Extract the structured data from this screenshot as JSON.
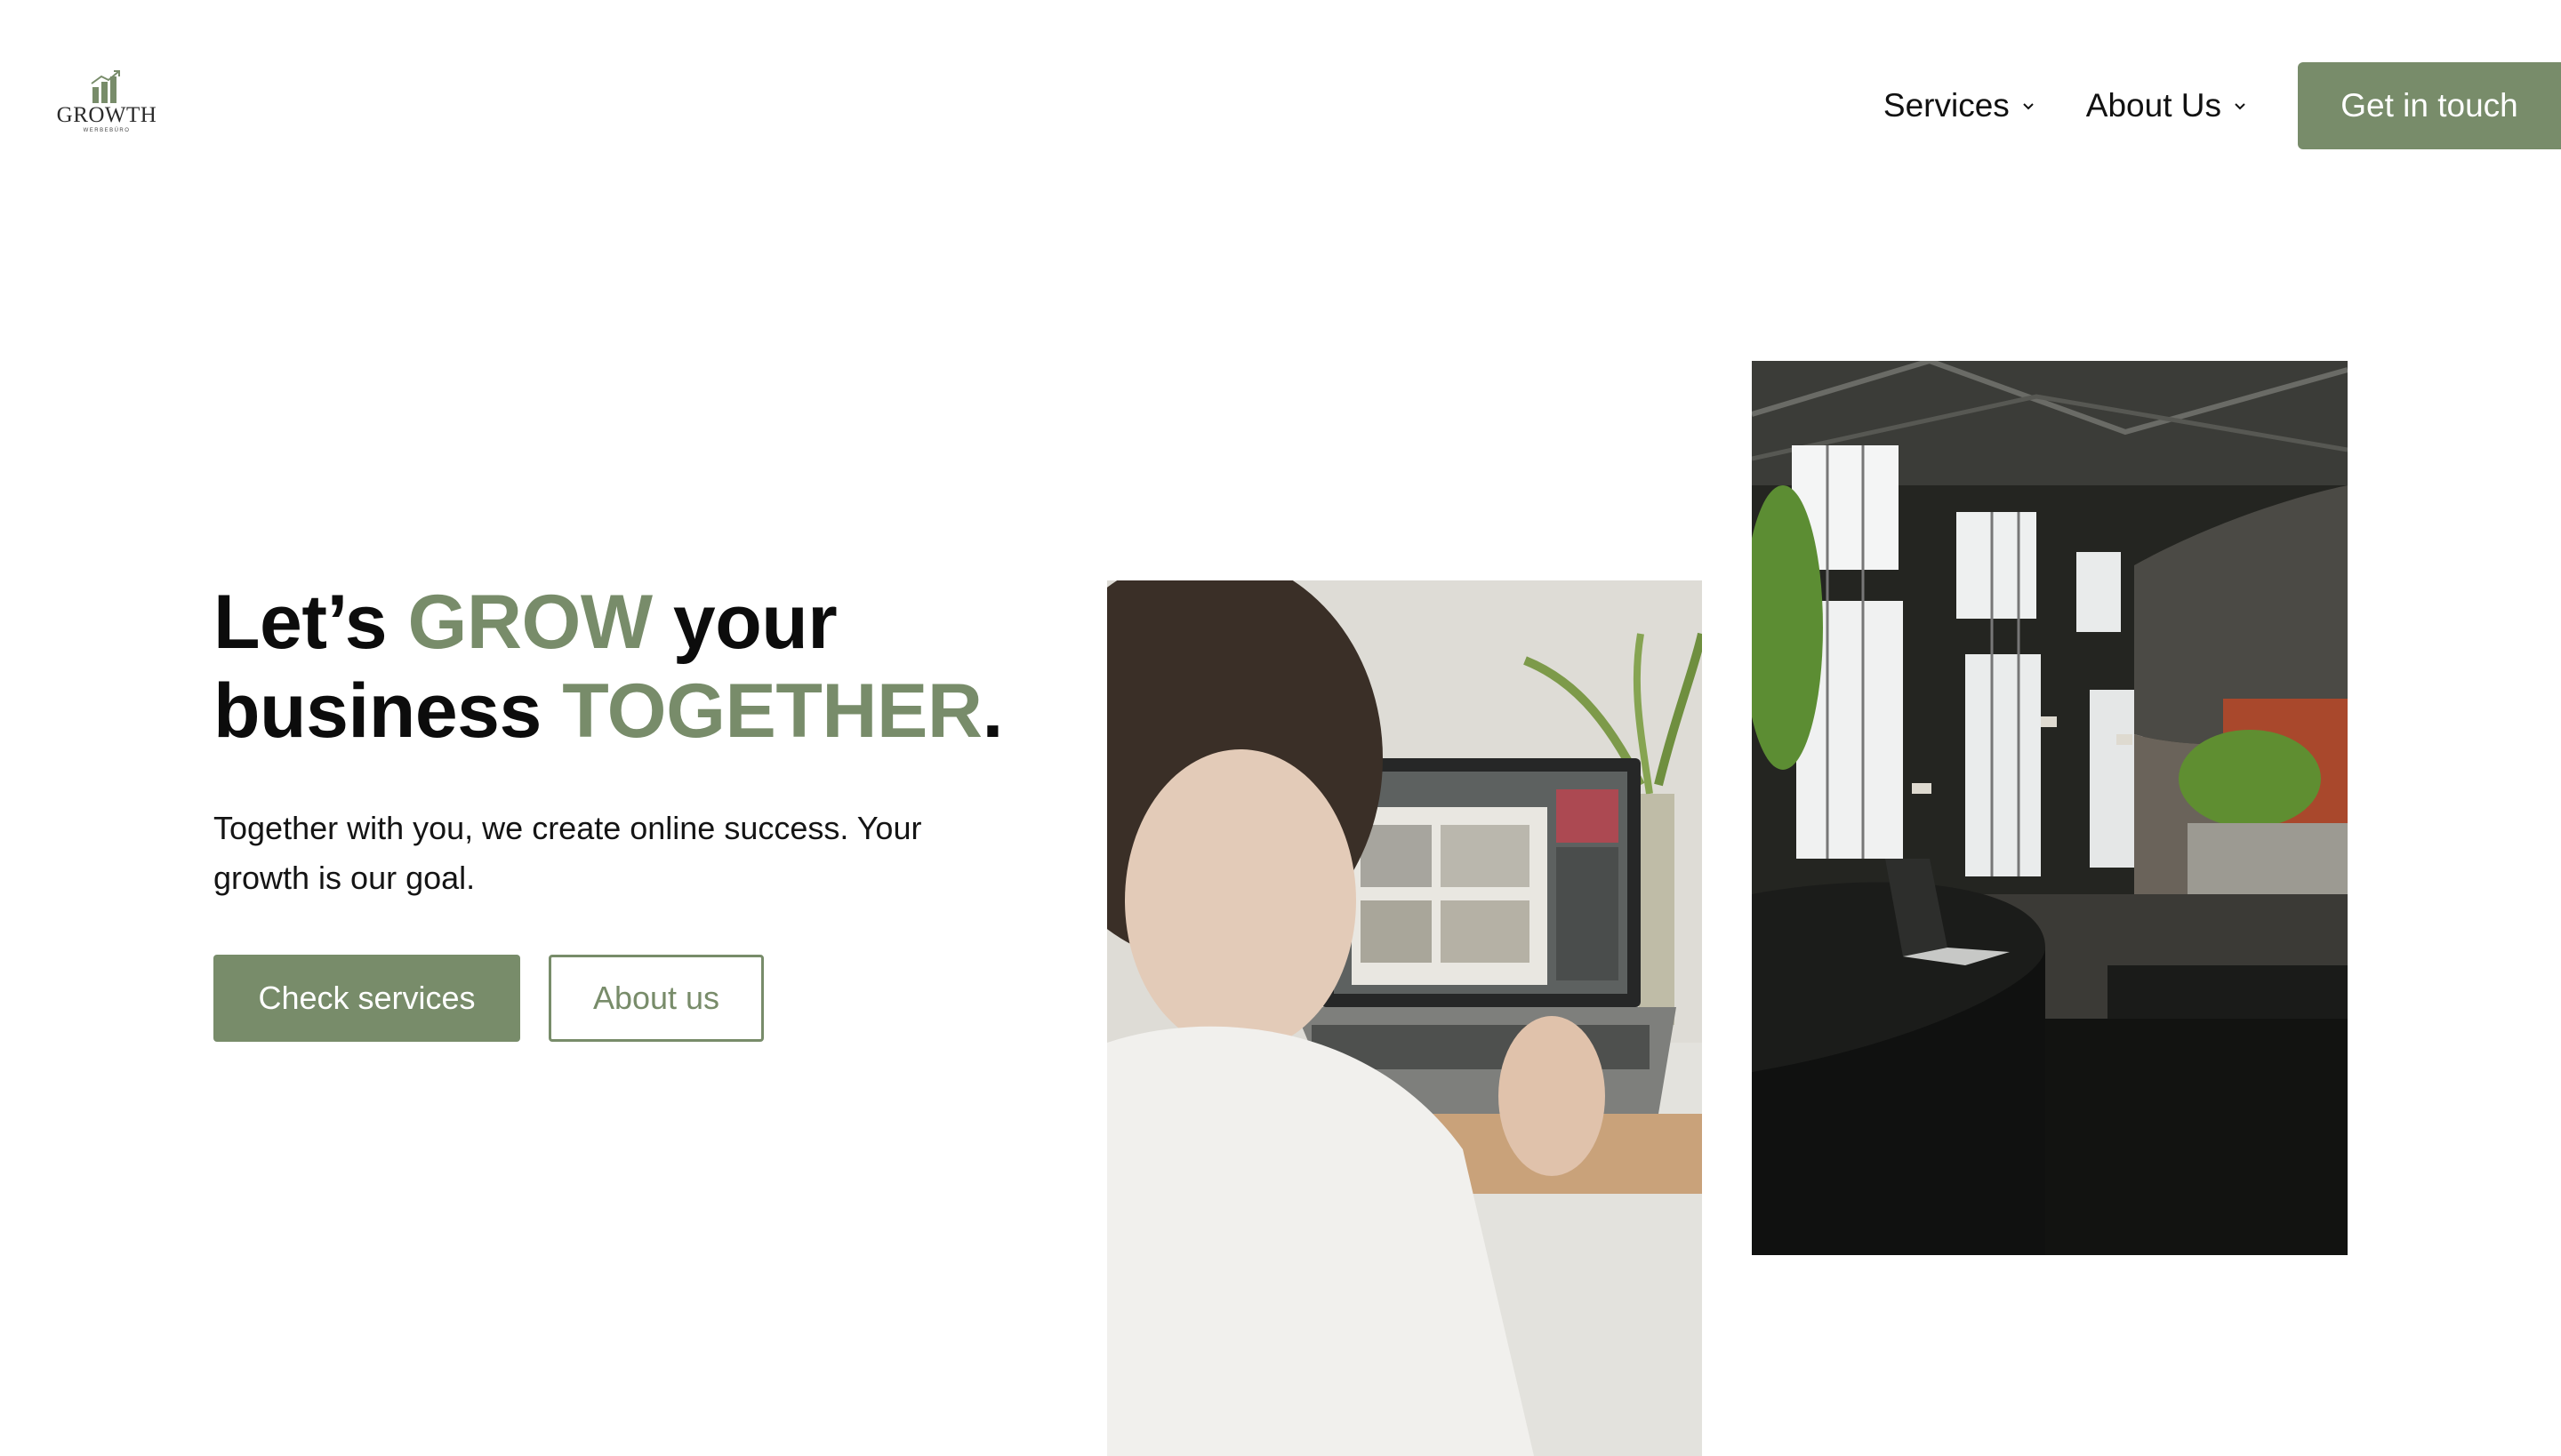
{
  "brand": {
    "name": "GROWTH",
    "tagline": "WERBEBÜRO",
    "logo_icon": "bar-chart-arrow-icon",
    "accent_color": "#788c6a"
  },
  "nav": {
    "items": [
      {
        "label": "Services",
        "icon": "chevron-down-icon"
      },
      {
        "label": "About Us",
        "icon": "chevron-down-icon"
      }
    ],
    "cta_label": "Get in touch"
  },
  "hero": {
    "title": {
      "part1": "Let’s ",
      "highlight1": "GROW",
      "part2": " your",
      "part3": "business ",
      "highlight2": "TOGETHER",
      "part4": "."
    },
    "subtitle": "Together with you, we create online success. Your growth is our goal.",
    "primary_button": "Check services",
    "secondary_button": "About us"
  },
  "images": {
    "photo1": "laptop-photo",
    "photo2": "office-interior-photo"
  }
}
